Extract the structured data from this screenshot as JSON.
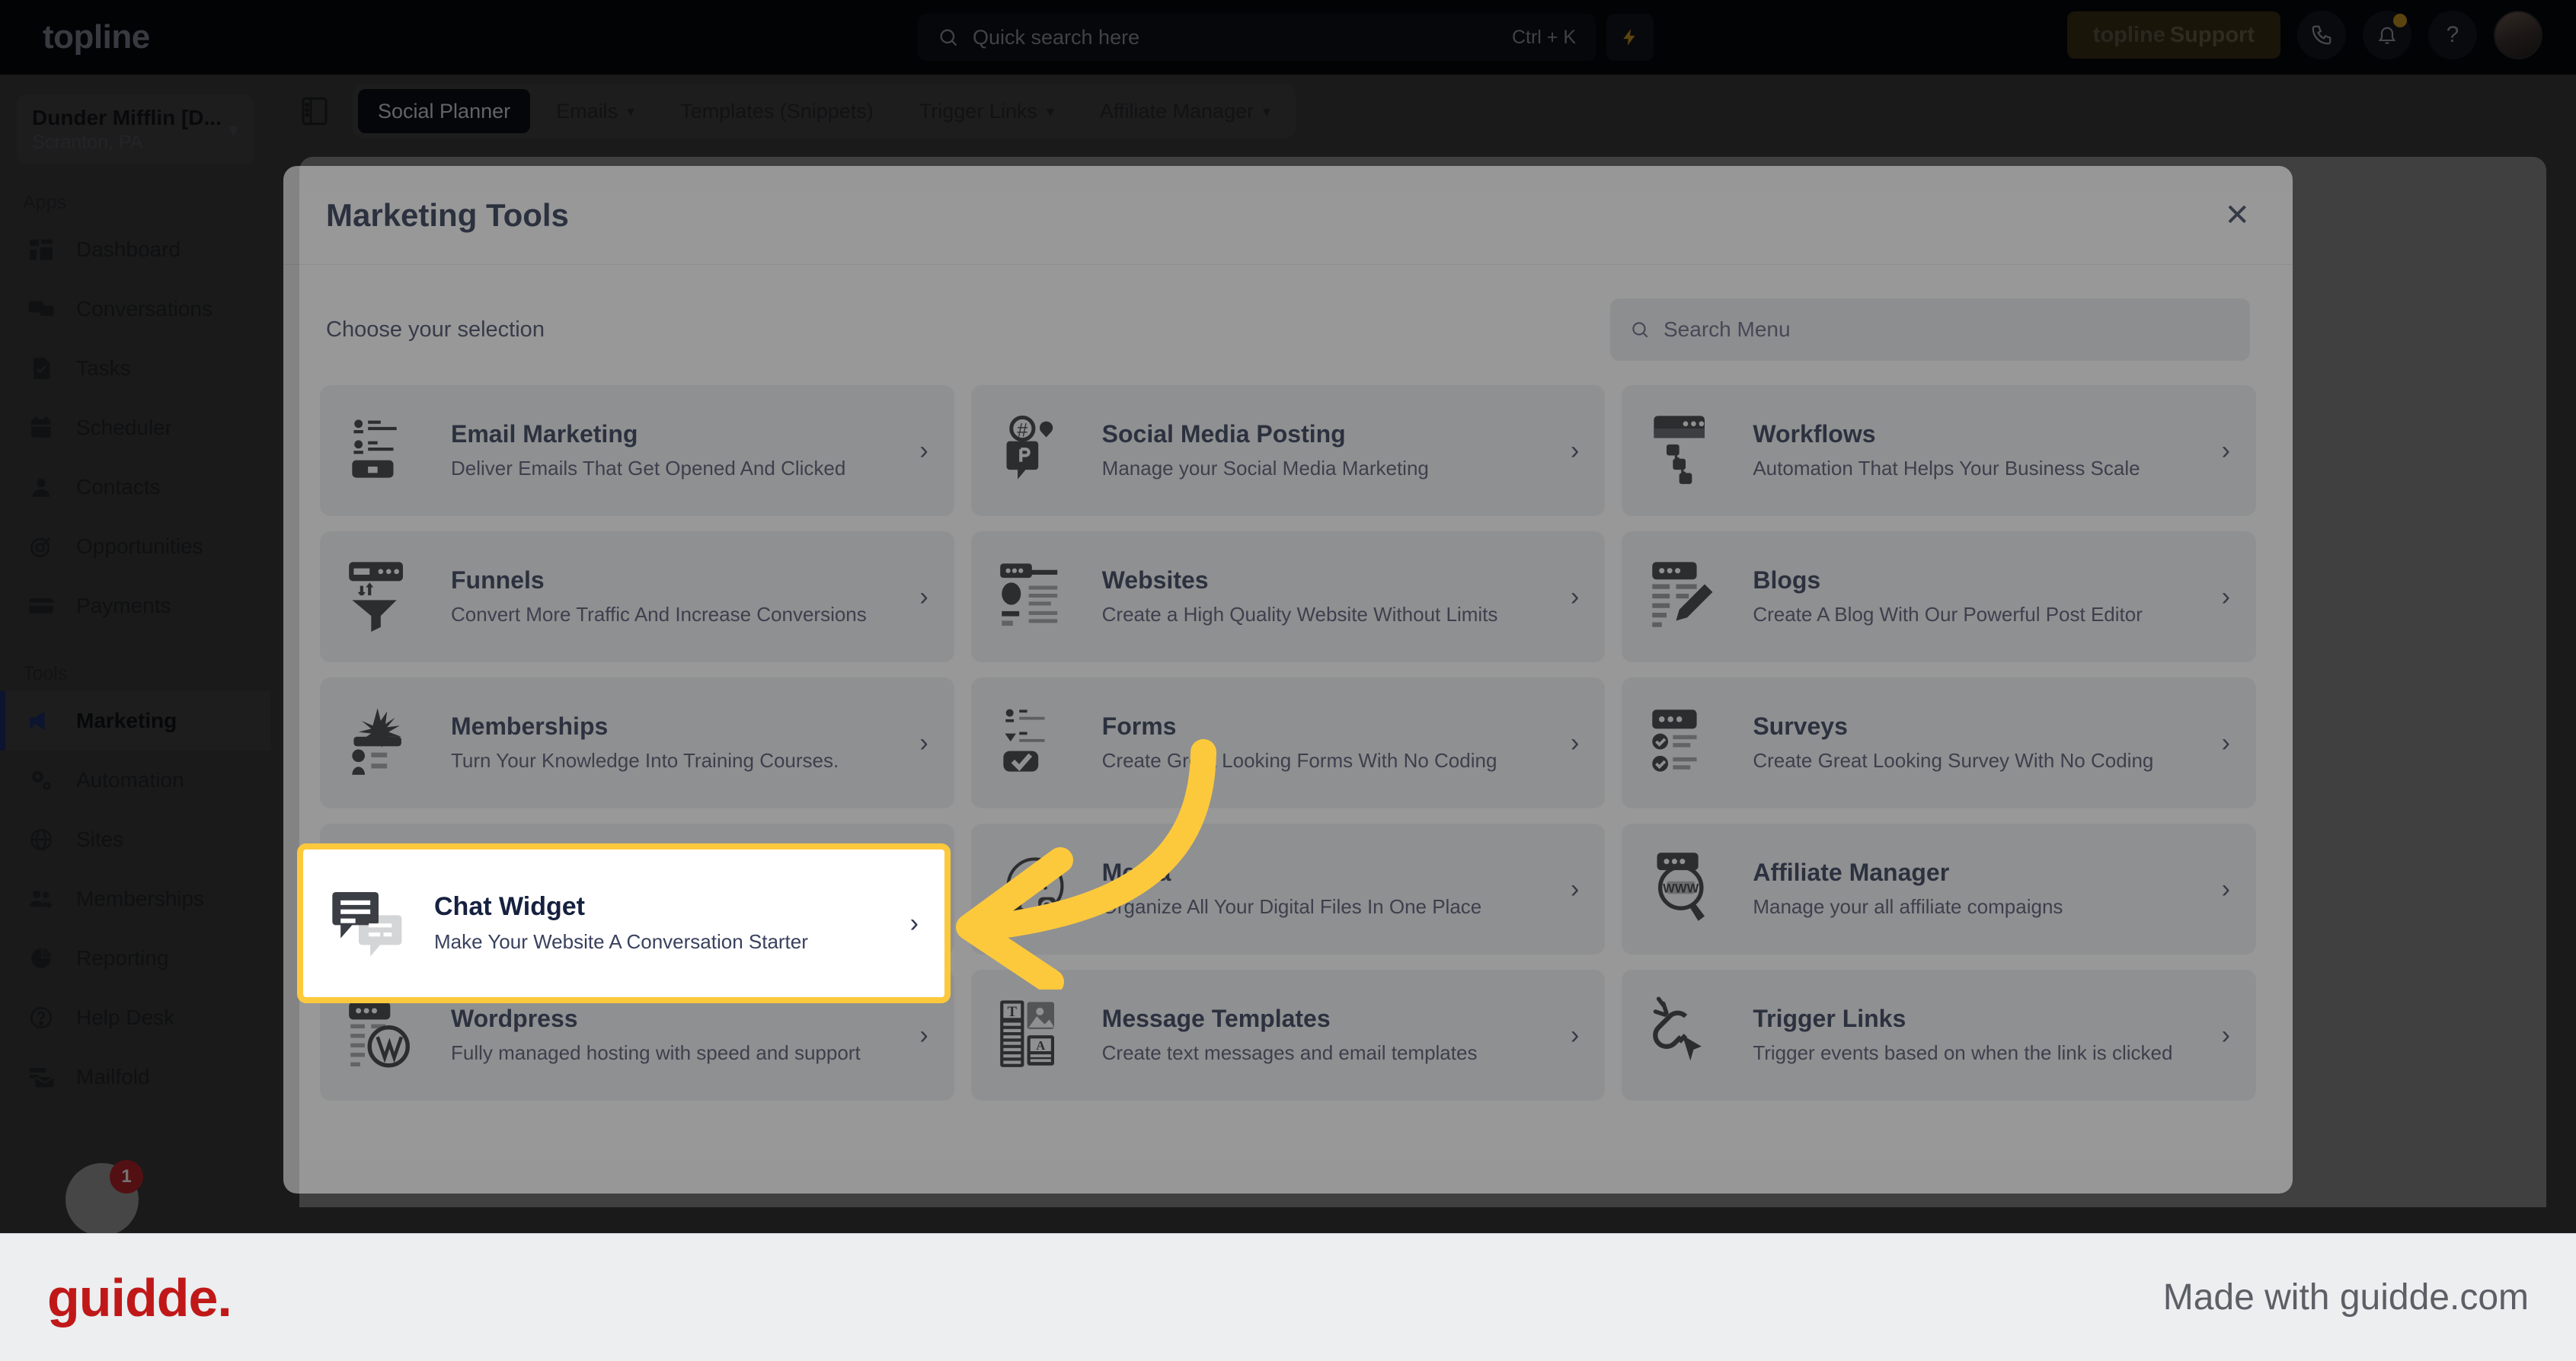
{
  "topbar": {
    "logo": "topline",
    "search": {
      "placeholder": "Quick search here",
      "shortcut": "Ctrl + K",
      "icon": "search-icon"
    },
    "bolt_icon": "lightning-bolt-icon",
    "support_button": {
      "brand": "topline",
      "label": " Support"
    },
    "phone_icon": "phone-icon",
    "bell_icon": "bell-icon",
    "help_icon": "question-mark-icon",
    "avatar": "user-avatar"
  },
  "sidebar": {
    "location": {
      "name": "Dunder Mifflin [D...",
      "sub": "Scranton, PA",
      "chevron": "chevron-down-icon"
    },
    "groups": [
      {
        "label": "Apps",
        "items": [
          {
            "label": "Dashboard",
            "icon": "dashboard-icon"
          },
          {
            "label": "Conversations",
            "icon": "chat-bubbles-icon"
          },
          {
            "label": "Tasks",
            "icon": "task-check-icon"
          },
          {
            "label": "Scheduler",
            "icon": "calendar-icon"
          },
          {
            "label": "Contacts",
            "icon": "person-icon"
          },
          {
            "label": "Opportunities",
            "icon": "target-icon"
          },
          {
            "label": "Payments",
            "icon": "credit-card-icon"
          }
        ]
      },
      {
        "label": "Tools",
        "items": [
          {
            "label": "Marketing",
            "icon": "megaphone-icon",
            "active": true
          },
          {
            "label": "Automation",
            "icon": "gears-icon"
          },
          {
            "label": "Sites",
            "icon": "globe-icon"
          },
          {
            "label": "Memberships",
            "icon": "people-add-icon"
          },
          {
            "label": "Reporting",
            "icon": "pie-chart-icon"
          },
          {
            "label": "Help Desk",
            "icon": "question-circle-icon"
          },
          {
            "label": "Mailfold",
            "icon": "mail-stack-icon"
          }
        ]
      }
    ],
    "fab_badge": "1"
  },
  "content": {
    "panel_toggle_icon": "panel-toggle-icon",
    "tabs": [
      {
        "label": "Social Planner",
        "active": true,
        "caret": false
      },
      {
        "label": "Emails",
        "active": false,
        "caret": true
      },
      {
        "label": "Templates (Snippets)",
        "active": false,
        "caret": false
      },
      {
        "label": "Trigger Links",
        "active": false,
        "caret": true
      },
      {
        "label": "Affiliate Manager",
        "active": false,
        "caret": true
      }
    ]
  },
  "modal": {
    "title": "Marketing Tools",
    "close_icon": "close-icon",
    "subtitle": "Choose your selection",
    "search": {
      "placeholder": "Search Menu",
      "icon": "search-icon"
    },
    "cards": [
      {
        "title": "Email Marketing",
        "desc": "Deliver Emails That Get Opened And Clicked",
        "icon": "email-marketing-icon"
      },
      {
        "title": "Social Media Posting",
        "desc": "Manage your Social Media Marketing",
        "icon": "social-media-icon"
      },
      {
        "title": "Workflows",
        "desc": "Automation That Helps Your Business Scale",
        "icon": "workflows-icon"
      },
      {
        "title": "Funnels",
        "desc": "Convert More Traffic And Increase Conversions",
        "icon": "funnel-icon"
      },
      {
        "title": "Websites",
        "desc": "Create a High Quality Website Without Limits",
        "icon": "website-icon"
      },
      {
        "title": "Blogs",
        "desc": "Create A Blog With Our Powerful Post Editor",
        "icon": "blog-pencil-icon"
      },
      {
        "title": "Memberships",
        "desc": "Turn Your Knowledge Into Training Courses.",
        "icon": "memberships-icon"
      },
      {
        "title": "Forms",
        "desc": "Create Great Looking Forms With No Coding",
        "icon": "forms-icon"
      },
      {
        "title": "Surveys",
        "desc": "Create Great Looking Survey With No Coding",
        "icon": "surveys-icon"
      },
      {
        "title": "Chat Widget",
        "desc": "Make Your Website A Conversation Starter",
        "icon": "chat-widget-icon"
      },
      {
        "title": "Media",
        "desc": "Organize All Your Digital Files In One Place",
        "icon": "media-icon"
      },
      {
        "title": "Affiliate Manager",
        "desc": "Manage your all affiliate compaigns",
        "icon": "affiliate-icon"
      },
      {
        "title": "Wordpress",
        "desc": "Fully managed hosting with speed and support",
        "icon": "wordpress-icon"
      },
      {
        "title": "Message Templates",
        "desc": "Create text messages and email templates",
        "icon": "message-templates-icon"
      },
      {
        "title": "Trigger Links",
        "desc": "Trigger events based on when the link is clicked",
        "icon": "trigger-links-icon"
      }
    ],
    "chevron_icon": "chevron-right-icon",
    "highlighted_card": {
      "title": "Chat Widget",
      "desc": "Make Your Website A Conversation Starter",
      "icon": "chat-widget-icon",
      "highlight_color": "#fcc93d"
    },
    "annotation_arrow": {
      "icon": "arrow-left-icon",
      "color": "#fcc93d"
    }
  },
  "footer": {
    "logo": "guidde.",
    "made_with": "Made with guidde.com"
  }
}
